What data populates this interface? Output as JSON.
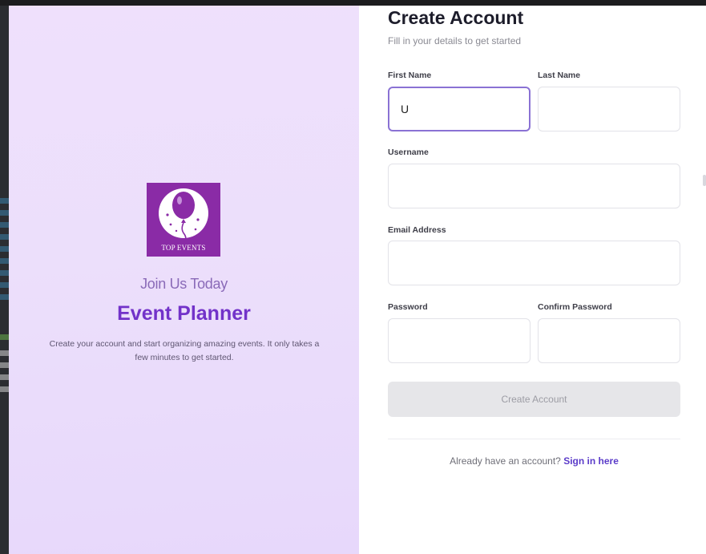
{
  "brand_panel": {
    "logo_text": "TOP EVENTS",
    "tagline": "Join Us Today",
    "title": "Event Planner",
    "description": "Create your account and start organizing amazing events. It only takes a few minutes to get started."
  },
  "form": {
    "title": "Create Account",
    "subtitle": "Fill in your details to get started",
    "first_name": {
      "label": "First Name",
      "value": "U"
    },
    "last_name": {
      "label": "Last Name",
      "value": ""
    },
    "username": {
      "label": "Username",
      "value": ""
    },
    "email": {
      "label": "Email Address",
      "value": ""
    },
    "password": {
      "label": "Password",
      "value": ""
    },
    "confirm_password": {
      "label": "Confirm Password",
      "value": ""
    },
    "submit_label": "Create Account",
    "signin_prompt": "Already have an account?",
    "signin_link": "Sign in here"
  },
  "colors": {
    "accent": "#7232c9",
    "logo_bg": "#8a2ba6",
    "focus_border": "#8a72d4",
    "link": "#5b3cc9",
    "button_disabled": "#e6e6e9"
  }
}
